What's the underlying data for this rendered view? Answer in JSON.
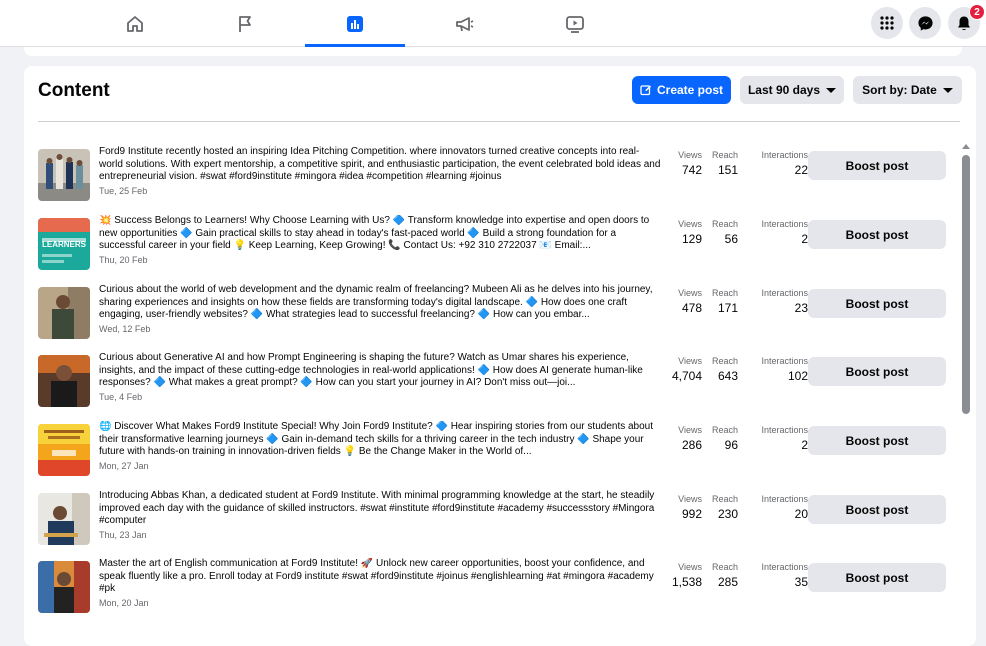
{
  "nav": {
    "tabs": [
      {
        "icon": "home-icon"
      },
      {
        "icon": "flag-icon"
      },
      {
        "icon": "bar-chart-icon",
        "active": true
      },
      {
        "icon": "megaphone-icon"
      },
      {
        "icon": "video-icon"
      }
    ],
    "notifications_count": "2",
    "accent": "#0866ff"
  },
  "content": {
    "title": "Content",
    "create_post_label": "Create post",
    "date_range_label": "Last 90 days",
    "sort_label": "Sort by: Date",
    "metric_labels": {
      "views": "Views",
      "reach": "Reach",
      "interactions": "Interactions"
    },
    "boost_label": "Boost post",
    "posts": [
      {
        "text": "Ford9 Institute recently hosted an inspiring Idea Pitching Competition. where innovators turned creative concepts into real-world solutions. With expert mentorship, a competitive spirit, and enthusiastic participation, the event celebrated bold ideas and entrepreneurial vision. #swat #ford9institute #mingora #idea #competition #learning #joinus",
        "date": "Tue, 25 Feb",
        "views": "742",
        "reach": "151",
        "interactions": "22"
      },
      {
        "text": "💥 Success Belongs to Learners! Why Choose Learning with Us? 🔷 Transform knowledge into expertise and open doors to new opportunities 🔷 Gain practical skills to stay ahead in today's fast-paced world 🔷 Build a strong foundation for a successful career in your field 💡 Keep Learning, Keep Growing! 📞 Contact Us: +92 310 2722037 📧 Email:...",
        "date": "Thu, 20 Feb",
        "views": "129",
        "reach": "56",
        "interactions": "2"
      },
      {
        "text": "Curious about the world of web development and the dynamic realm of freelancing? Mubeen Ali as he delves into his journey, sharing experiences and insights on how these fields are transforming today's digital landscape. 🔷 How does one craft engaging, user-friendly websites? 🔷 What strategies lead to successful freelancing? 🔷 How can you embar...",
        "date": "Wed, 12 Feb",
        "views": "478",
        "reach": "171",
        "interactions": "23"
      },
      {
        "text": "Curious about Generative AI and how Prompt Engineering is shaping the future? Watch as Umar shares his experience, insights, and the impact of these cutting-edge technologies in real-world applications! 🔷 How does AI generate human-like responses? 🔷 What makes a great prompt? 🔷 How can you start your journey in AI? Don't miss out—joi...",
        "date": "Tue, 4 Feb",
        "views": "4,704",
        "reach": "643",
        "interactions": "102"
      },
      {
        "text": "🌐 Discover What Makes Ford9 Institute Special! Why Join Ford9 Institute? 🔷 Hear inspiring stories from our students about their transformative learning journeys 🔷 Gain in-demand tech skills for a thriving career in the tech industry 🔷 Shape your future with hands-on training in innovation-driven fields 💡 Be the Change Maker in the World of...",
        "date": "Mon, 27 Jan",
        "views": "286",
        "reach": "96",
        "interactions": "2"
      },
      {
        "text": "Introducing Abbas Khan, a dedicated student at Ford9 Institute. With minimal programming knowledge at the start, he steadily improved each day with the guidance of skilled instructors. #swat #institute #ford9institute #academy #successstory #Mingora #computer",
        "date": "Thu, 23 Jan",
        "views": "992",
        "reach": "230",
        "interactions": "20"
      },
      {
        "text": "Master the art of English communication at Ford9 Institute! 🚀 Unlock new career opportunities, boost your confidence, and speak fluently like a pro. Enroll today at Ford9 institute #swat #ford9institute #joinus #englishlearning #at #mingora #academy #pk",
        "date": "Mon, 20 Jan",
        "views": "1,538",
        "reach": "285",
        "interactions": "35"
      }
    ],
    "thumb_images": [
      {
        "thumb_label": ""
      },
      {
        "thumb_label": "LEARNERS"
      },
      {
        "thumb_label": ""
      },
      {
        "thumb_label": ""
      },
      {
        "thumb_label": ""
      },
      {
        "thumb_label": ""
      },
      {
        "thumb_label": ""
      }
    ]
  }
}
